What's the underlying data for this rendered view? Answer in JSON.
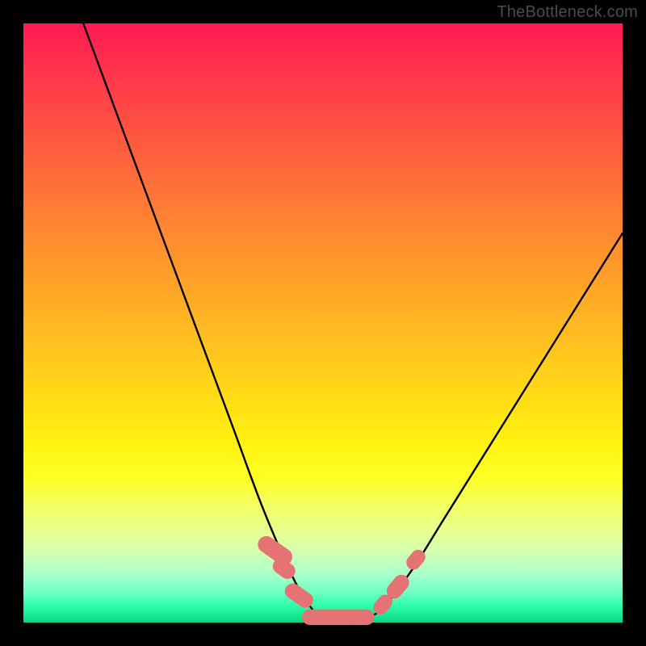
{
  "attribution": "TheBottleneck.com",
  "chart_data": {
    "type": "line",
    "title": "",
    "xlabel": "",
    "ylabel": "",
    "xlim": [
      0,
      100
    ],
    "ylim": [
      0,
      100
    ],
    "grid": false,
    "series": [
      {
        "name": "curve",
        "color": "#000000",
        "x": [
          10,
          15,
          20,
          25,
          30,
          35,
          40,
          45,
          48,
          50,
          53,
          57,
          60,
          65,
          70,
          75,
          80,
          85,
          90,
          95,
          100
        ],
        "y": [
          100,
          86.5,
          73,
          59.5,
          46,
          32.5,
          19,
          7.5,
          2.5,
          0.8,
          0.6,
          0.8,
          2.5,
          9,
          17,
          25,
          33,
          41,
          49,
          57,
          65
        ]
      }
    ],
    "markers": [
      {
        "shape": "pill",
        "cx": 42.0,
        "cy": 12.0,
        "rx": 1.4,
        "ry": 3.2,
        "angle": -55
      },
      {
        "shape": "pill",
        "cx": 43.5,
        "cy": 9.0,
        "rx": 1.3,
        "ry": 2.0,
        "angle": -55
      },
      {
        "shape": "pill",
        "cx": 46.0,
        "cy": 4.5,
        "rx": 1.3,
        "ry": 2.6,
        "angle": -55
      },
      {
        "shape": "pill",
        "cx": 51.0,
        "cy": 0.9,
        "rx": 4.5,
        "ry": 1.3,
        "angle": 0
      },
      {
        "shape": "pill",
        "cx": 56.0,
        "cy": 0.9,
        "rx": 2.6,
        "ry": 1.3,
        "angle": 0
      },
      {
        "shape": "pill",
        "cx": 60.0,
        "cy": 3.0,
        "rx": 1.2,
        "ry": 1.8,
        "angle": 40
      },
      {
        "shape": "pill",
        "cx": 62.5,
        "cy": 6.0,
        "rx": 1.3,
        "ry": 2.2,
        "angle": 40
      },
      {
        "shape": "pill",
        "cx": 65.5,
        "cy": 10.5,
        "rx": 1.2,
        "ry": 1.8,
        "angle": 40
      }
    ],
    "marker_color": "#e57373"
  }
}
